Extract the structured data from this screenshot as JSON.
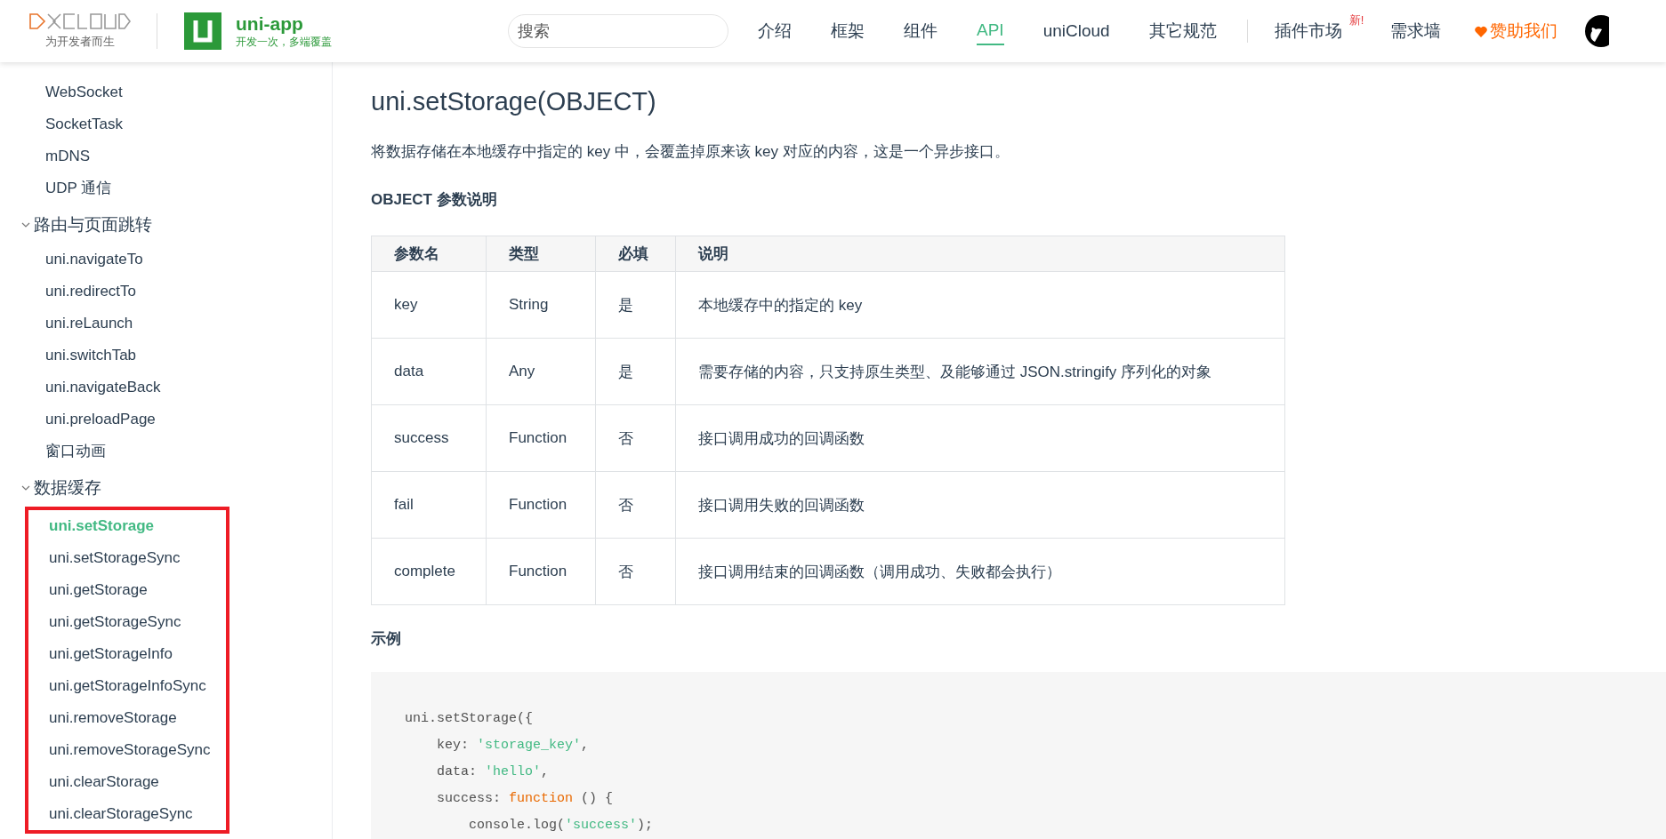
{
  "header": {
    "logo_tagline": "为开发者而生",
    "product_name": "uni-app",
    "product_slogan": "开发一次，多端覆盖",
    "search": {
      "placeholder": "搜索"
    },
    "nav": [
      {
        "label": "介绍",
        "selected": false
      },
      {
        "label": "框架",
        "selected": false
      },
      {
        "label": "组件",
        "selected": false
      },
      {
        "label": "API",
        "selected": true
      },
      {
        "label": "uniCloud",
        "selected": false
      },
      {
        "label": "其它规范",
        "selected": false
      }
    ],
    "links": [
      {
        "label": "插件市场",
        "badge": "新!",
        "kind": "plain"
      },
      {
        "label": "需求墙",
        "kind": "plain"
      },
      {
        "label": "赞助我们",
        "kind": "sponsor"
      }
    ]
  },
  "sidebar": {
    "items": [
      {
        "label": "WebSocket",
        "selected": false
      },
      {
        "label": "SocketTask",
        "selected": false
      },
      {
        "label": "mDNS",
        "selected": false
      },
      {
        "label": "UDP 通信",
        "selected": false
      }
    ],
    "groups": [
      {
        "label": "路由与页面跳转",
        "expanded": true,
        "highlighted": false,
        "children": [
          {
            "label": "uni.navigateTo",
            "selected": false
          },
          {
            "label": "uni.redirectTo",
            "selected": false
          },
          {
            "label": "uni.reLaunch",
            "selected": false
          },
          {
            "label": "uni.switchTab",
            "selected": false
          },
          {
            "label": "uni.navigateBack",
            "selected": false
          },
          {
            "label": "uni.preloadPage",
            "selected": false
          },
          {
            "label": "窗口动画",
            "selected": false
          }
        ]
      },
      {
        "label": "数据缓存",
        "expanded": true,
        "highlighted": true,
        "children": [
          {
            "label": "uni.setStorage",
            "selected": true
          },
          {
            "label": "uni.setStorageSync",
            "selected": false
          },
          {
            "label": "uni.getStorage",
            "selected": false
          },
          {
            "label": "uni.getStorageSync",
            "selected": false
          },
          {
            "label": "uni.getStorageInfo",
            "selected": false
          },
          {
            "label": "uni.getStorageInfoSync",
            "selected": false
          },
          {
            "label": "uni.removeStorage",
            "selected": false
          },
          {
            "label": "uni.removeStorageSync",
            "selected": false
          },
          {
            "label": "uni.clearStorage",
            "selected": false
          },
          {
            "label": "uni.clearStorageSync",
            "selected": false
          }
        ]
      }
    ]
  },
  "content": {
    "title": "uni.setStorage(OBJECT)",
    "description": "将数据存储在本地缓存中指定的 key 中，会覆盖掉原来该 key 对应的内容，这是一个异步接口。",
    "params_heading": "OBJECT 参数说明",
    "table": {
      "columns": [
        "参数名",
        "类型",
        "必填",
        "说明"
      ],
      "rows": [
        [
          "key",
          "String",
          "是",
          "本地缓存中的指定的 key"
        ],
        [
          "data",
          "Any",
          "是",
          "需要存储的内容，只支持原生类型、及能够通过 JSON.stringify 序列化的对象"
        ],
        [
          "success",
          "Function",
          "否",
          "接口调用成功的回调函数"
        ],
        [
          "fail",
          "Function",
          "否",
          "接口调用失败的回调函数"
        ],
        [
          "complete",
          "Function",
          "否",
          "接口调用结束的回调函数（调用成功、失败都会执行）"
        ]
      ]
    },
    "example_heading": "示例",
    "code": [
      [
        {
          "text": "uni.setStorage({",
          "kind": "plain"
        }
      ],
      [
        {
          "text": "    key: ",
          "kind": "plain"
        },
        {
          "text": "'storage_key'",
          "kind": "string"
        },
        {
          "text": ",",
          "kind": "plain"
        }
      ],
      [
        {
          "text": "    data: ",
          "kind": "plain"
        },
        {
          "text": "'hello'",
          "kind": "string"
        },
        {
          "text": ",",
          "kind": "plain"
        }
      ],
      [
        {
          "text": "    success: ",
          "kind": "plain"
        },
        {
          "text": "function",
          "kind": "keyword"
        },
        {
          "text": " () {",
          "kind": "plain"
        }
      ],
      [
        {
          "text": "        console.log(",
          "kind": "plain"
        },
        {
          "text": "'success'",
          "kind": "string"
        },
        {
          "text": ");",
          "kind": "plain"
        }
      ]
    ]
  }
}
